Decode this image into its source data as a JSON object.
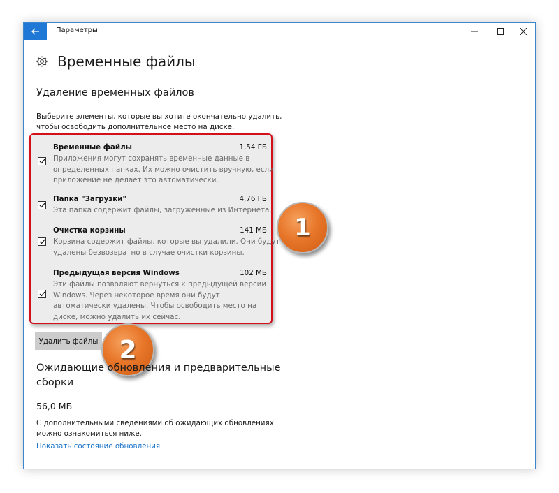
{
  "window": {
    "title": "Параметры",
    "accent_color": "#1f78d6"
  },
  "header": {
    "icon": "gear-icon",
    "title": "Временные файлы"
  },
  "cleanup": {
    "section_title": "Удаление временных файлов",
    "description": [
      "Выберите элементы, которые вы хотите окончательно удалить,",
      "чтобы освободить дополнительное место на диске."
    ],
    "items": [
      {
        "title": "Временные файлы",
        "size": "1,54 ГБ",
        "checked": true,
        "description": [
          "Приложения могут сохранять временные данные в",
          "определенных папках. Их можно очистить вручную, если",
          "приложение не делает это автоматически."
        ]
      },
      {
        "title": "Папка \"Загрузки\"",
        "size": "4,76 ГБ",
        "checked": true,
        "description": [
          "Эта папка содержит файлы, загруженные из Интернета."
        ]
      },
      {
        "title": "Очистка корзины",
        "size": "141 МБ",
        "checked": true,
        "description": [
          "Корзина содержит файлы, которые вы удалили. Они будут",
          "удалены безвозвратно в случае очистки корзины."
        ]
      },
      {
        "title": "Предыдущая версия Windows",
        "size": "102 МБ",
        "checked": true,
        "description": [
          "Эти файлы позволяют вернуться к предыдущей версии",
          "Windows. Через некоторое время они будут",
          "автоматически удалены. Чтобы освободить место на",
          "диске, можно удалить их сейчас."
        ]
      }
    ],
    "delete_button_label": "Удалить файлы"
  },
  "annotations": {
    "badge_1": "1",
    "badge_2": "2",
    "highlight_color": "#d2111b",
    "badge_color": "#e8772a"
  },
  "pending": {
    "title": [
      "Ожидающие обновления и предварительные",
      "сборки"
    ],
    "size": "56,0 МБ",
    "description": [
      "С дополнительными сведениями об ожидающих обновлениях",
      "можно ознакомиться ниже."
    ],
    "link_label": "Показать состояние обновления"
  }
}
